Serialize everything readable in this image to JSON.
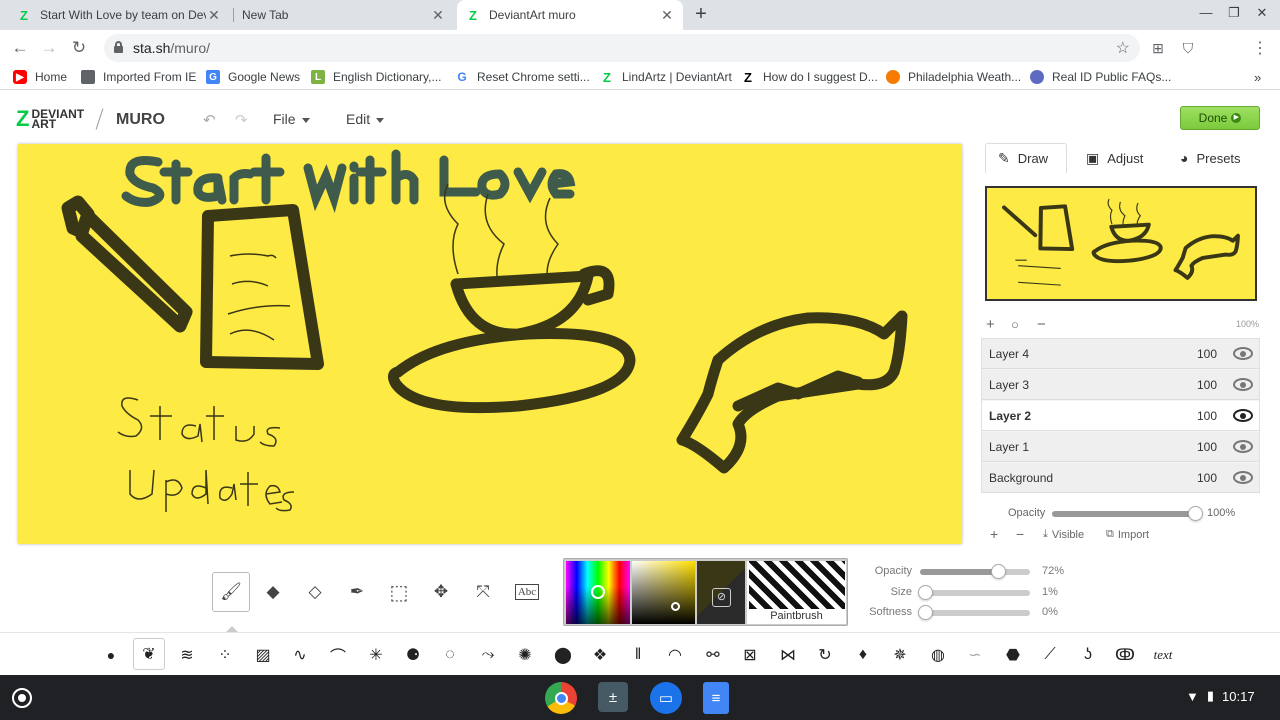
{
  "browser": {
    "tabs": [
      {
        "title": "Start With Love by team on DeviantArt",
        "icon": "deviantart-icon",
        "active": false
      },
      {
        "title": "New Tab",
        "icon": "",
        "active": false
      },
      {
        "title": "DeviantArt muro",
        "icon": "deviantart-icon",
        "active": true
      }
    ],
    "url_host": "sta.sh",
    "url_path": "/muro/",
    "bookmarks": [
      {
        "label": "Home",
        "icon": "youtube-icon"
      },
      {
        "label": "Imported From IE",
        "icon": "folder-icon"
      },
      {
        "label": "Google News",
        "icon": "google-news-icon"
      },
      {
        "label": "English Dictionary,...",
        "icon": "dictionary-icon"
      },
      {
        "label": "Reset Chrome setti...",
        "icon": "google-icon"
      },
      {
        "label": "LindArtz | DeviantArt",
        "icon": "deviantart-icon"
      },
      {
        "label": "How do I suggest D...",
        "icon": "deviantart-icon"
      },
      {
        "label": "Philadelphia Weath...",
        "icon": "weather-icon"
      },
      {
        "label": "Real ID Public FAQs...",
        "icon": "seal-icon"
      }
    ]
  },
  "muro": {
    "logo": "DEVIANTART",
    "logo_top": "DEVIANT",
    "logo_bottom": "ART",
    "app_name": "MURO",
    "menus": [
      "File",
      "Edit"
    ],
    "done_label": "Done",
    "side_tabs": [
      "Draw",
      "Adjust",
      "Presets"
    ],
    "zoom": "100%",
    "layers": [
      {
        "name": "Layer 4",
        "opacity": "100",
        "selected": false
      },
      {
        "name": "Layer 3",
        "opacity": "100",
        "selected": false
      },
      {
        "name": "Layer 2",
        "opacity": "100",
        "selected": true
      },
      {
        "name": "Layer 1",
        "opacity": "100",
        "selected": false
      },
      {
        "name": "Background",
        "opacity": "100",
        "selected": false
      }
    ],
    "layer_opacity_label": "Opacity",
    "layer_opacity_value": "100%",
    "layer_opacity_fraction": 1.0,
    "layer_actions": [
      "Visible",
      "Import"
    ],
    "brush_name": "Paintbrush",
    "brush_settings": [
      {
        "label": "Opacity",
        "value": "72%",
        "fraction": 0.72
      },
      {
        "label": "Size",
        "value": "1%",
        "fraction": 0.01
      },
      {
        "label": "Softness",
        "value": "0%",
        "fraction": 0.0
      }
    ],
    "current_color": "#3a3716",
    "canvas_color": "#fdea44",
    "text_brush_label": "text"
  },
  "taskbar": {
    "apps": [
      "chrome-icon",
      "calculator-icon",
      "files-icon",
      "docs-icon"
    ],
    "time": "10:17"
  }
}
